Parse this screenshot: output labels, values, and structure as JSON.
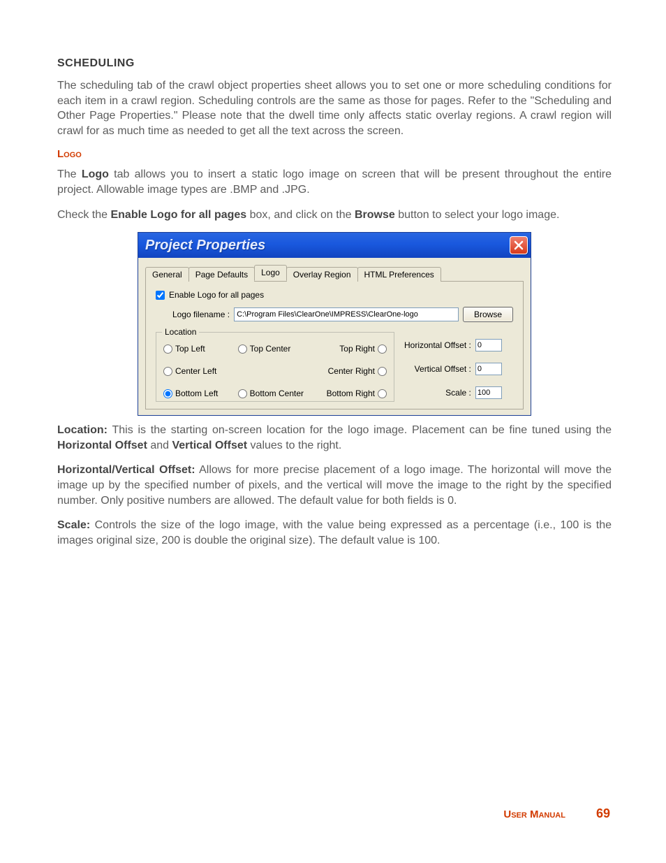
{
  "headings": {
    "scheduling": "SCHEDULING",
    "logo": "Logo"
  },
  "text": {
    "scheduling_para": "The scheduling tab of the crawl object properties sheet allows you to set one or more scheduling conditions for each item in a crawl region. Scheduling controls are the same as those for pages. Refer to the \"Scheduling and Other Page Properties.\" Please note that the dwell time only affects static overlay regions. A crawl region will crawl for as much time as needed to get all the text across the screen.",
    "logo_para_pre": "The ",
    "logo_para_b1": "Logo",
    "logo_para_rest": " tab allows you to insert a static logo image on screen that will be present throughout the entire project. Allowable image types are .BMP and .JPG.",
    "check_pre": "Check the ",
    "check_b1": "Enable Logo for all pages",
    "check_mid": " box, and click on the ",
    "check_b2": "Browse",
    "check_end": " button to select your logo image.",
    "location_b": "Location:",
    "location_rest": " This is the starting on-screen location for the logo image. Placement can be fine tuned using the ",
    "location_b2": "Horizontal Offset",
    "location_and": " and ",
    "location_b3": "Vertical Offset",
    "location_end": " values to the right.",
    "hv_b": "Horizontal/Vertical Offset:",
    "hv_rest": " Allows for more precise placement of a logo image. The horizontal will move the image up by the specified number of pixels, and the vertical will move the image to the right by the specified number. Only positive numbers are allowed. The default value for both fields is 0.",
    "scale_b": "Scale:",
    "scale_rest": " Controls the size of the logo image, with the value being expressed as a percentage (i.e., 100 is the images original size, 200 is double the original size). The default value is 100."
  },
  "dialog": {
    "title": "Project Properties",
    "tabs": {
      "general": "General",
      "page_defaults": "Page Defaults",
      "logo": "Logo",
      "overlay_region": "Overlay Region",
      "html_prefs": "HTML Preferences"
    },
    "enable_label": "Enable Logo for all pages",
    "filename_label": "Logo filename :",
    "filename_value": "C:\\Program Files\\ClearOne\\IMPRESS\\ClearOne-logo",
    "browse": "Browse",
    "location_legend": "Location",
    "loc": {
      "tl": "Top Left",
      "tc": "Top Center",
      "tr": "Top Right",
      "cl": "Center Left",
      "cr": "Center Right",
      "bl": "Bottom Left",
      "bc": "Bottom Center",
      "br": "Bottom Right"
    },
    "h_offset_label": "Horizontal Offset :",
    "v_offset_label": "Vertical Offset :",
    "scale_label": "Scale :",
    "h_offset_value": "0",
    "v_offset_value": "0",
    "scale_value": "100"
  },
  "footer": {
    "label": "User Manual",
    "page": "69"
  }
}
